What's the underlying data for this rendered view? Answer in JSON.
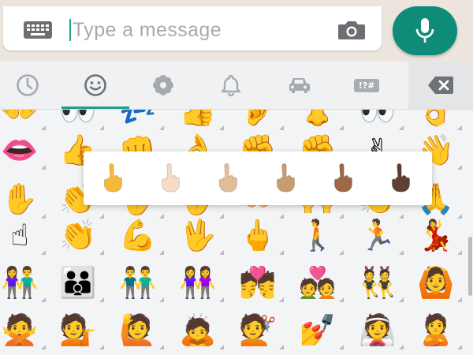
{
  "composer": {
    "placeholder": "Type a message",
    "value": ""
  },
  "colors": {
    "accent": "#0e8c79",
    "tab_underline": "#1d9e89",
    "tab_icon": "#a6a9ad",
    "tab_icon_active": "#6e7175"
  },
  "icons": {
    "keyboard": "keyboard-icon",
    "camera": "camera-icon",
    "mic": "microphone-icon",
    "backspace": "backspace-icon"
  },
  "tabs": [
    {
      "name": "recent",
      "icon": "clock-icon",
      "active": false
    },
    {
      "name": "smileys-people",
      "icon": "smiley-icon",
      "active": true
    },
    {
      "name": "nature",
      "icon": "flower-icon",
      "active": false
    },
    {
      "name": "objects",
      "icon": "bell-icon",
      "active": false
    },
    {
      "name": "places",
      "icon": "car-icon",
      "active": false
    },
    {
      "name": "symbols",
      "icon": "symbols-icon",
      "label": "!?#",
      "active": false
    }
  ],
  "emoji_rows": [
    [
      "👐",
      "👀",
      "💤",
      "👍",
      "👂",
      "👃",
      "👀",
      "👌"
    ],
    [
      "👄",
      "👍",
      "👊",
      "👌",
      "✊",
      "✊",
      "✌",
      "👋"
    ],
    [
      "✋",
      "👏",
      "🖐",
      "🖐",
      "👐",
      "🙌",
      "👏",
      "🙏"
    ],
    [
      "☝",
      "👏",
      "💪",
      "🖖",
      "🖕",
      "🚶",
      "🏃",
      "💃"
    ],
    [
      "👫",
      "👪",
      "👬",
      "👭",
      "💏",
      "💑",
      "👯",
      "🙆"
    ],
    [
      "🙅",
      "💁",
      "🙋",
      "🙇",
      "💇",
      "💅",
      "👰",
      "🙎"
    ]
  ],
  "skin_tone_popup": {
    "emoji": "🖕",
    "tones": [
      "#f5b93a",
      "#f4dcc8",
      "#e2bd98",
      "#c89b70",
      "#9b6a44",
      "#5e4032"
    ]
  }
}
